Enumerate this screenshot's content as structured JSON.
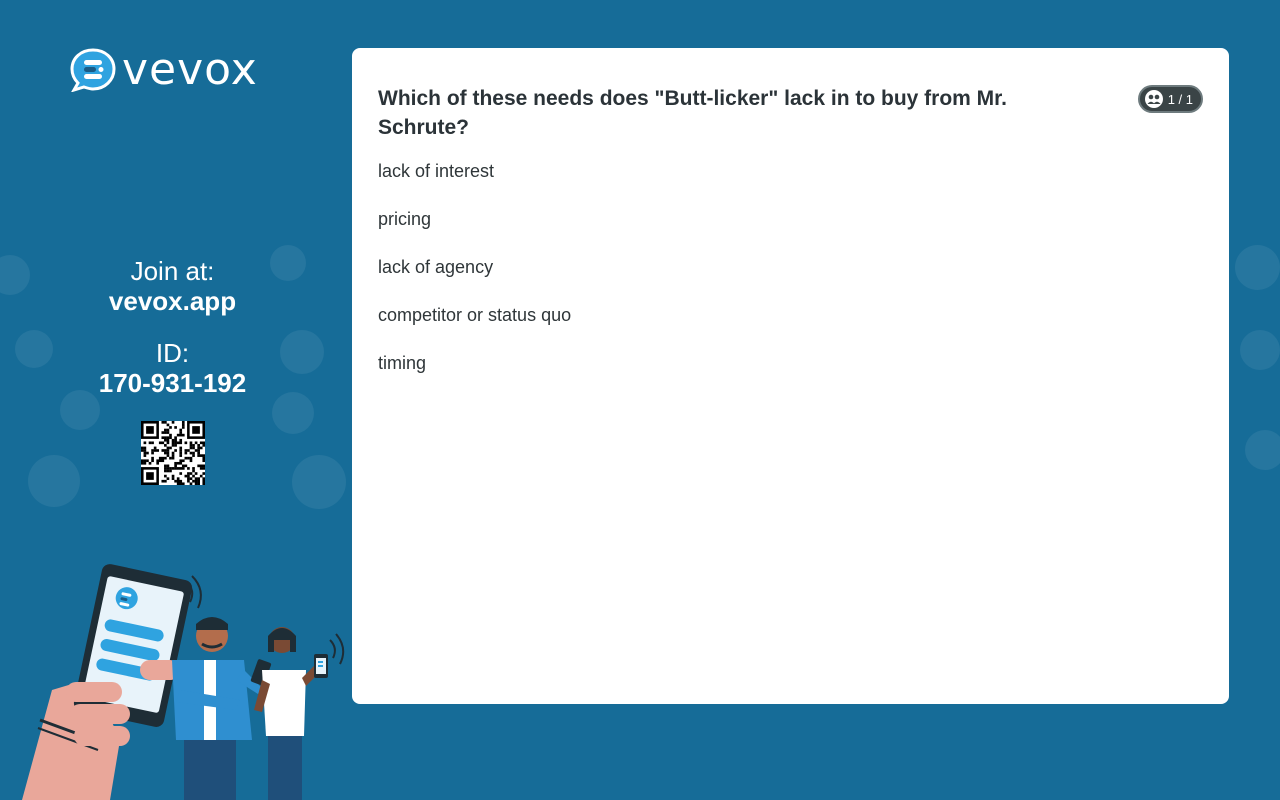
{
  "brand": {
    "name": "vevox"
  },
  "join": {
    "label": "Join at:",
    "url": "vevox.app",
    "id_label": "ID:",
    "id_value": "170-931-192"
  },
  "question": {
    "text": "Which of these needs does \"Butt-licker\" lack in to buy from Mr. Schrute?",
    "counter": "1 / 1",
    "options": [
      "lack of interest",
      "pricing",
      "lack of agency",
      "competitor or status quo",
      "timing"
    ]
  },
  "colors": {
    "background": "#166c98",
    "card": "#ffffff",
    "badge": "#3a4446",
    "accent_blue": "#2fa3e0"
  },
  "icons": {
    "logo": "vevox-chat-bubble-icon",
    "badge": "participants-icon",
    "qr": "qr-code"
  }
}
